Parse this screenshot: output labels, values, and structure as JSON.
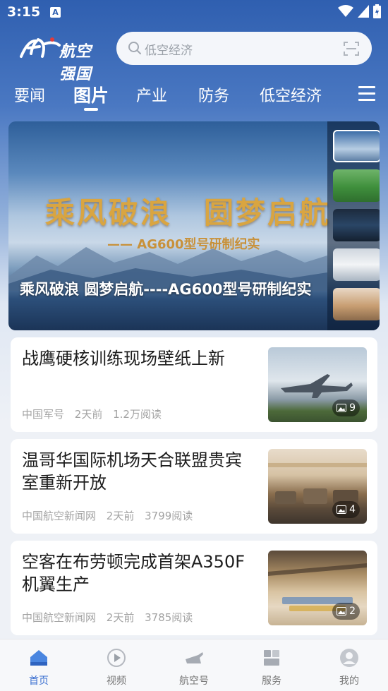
{
  "status_bar": {
    "time": "3:15",
    "notif_icon": "a-notification-icon"
  },
  "header": {
    "logo_text": "航空强国",
    "search": {
      "placeholder": "低空经济"
    }
  },
  "tabs": [
    {
      "label": "要闻"
    },
    {
      "label": "图片"
    },
    {
      "label": "产业"
    },
    {
      "label": "防务"
    },
    {
      "label": "低空经济"
    }
  ],
  "active_tab": "图片",
  "banner": {
    "big_title": "乘风破浪　圆梦启航",
    "subtitle": "—— AG600型号研制纪实",
    "caption": "乘风破浪 圆梦启航----AG600型号研制纪实"
  },
  "news": [
    {
      "title": "战鹰硬核训练现场壁纸上新",
      "source": "中国军号",
      "time": "2天前",
      "reads": "1.2万阅读",
      "image_count": "9"
    },
    {
      "title": "温哥华国际机场天合联盟贵宾室重新开放",
      "source": "中国航空新闻网",
      "time": "2天前",
      "reads": "3799阅读",
      "image_count": "4"
    },
    {
      "title": "空客在布劳顿完成首架A350F机翼生产",
      "source": "中国航空新闻网",
      "time": "2天前",
      "reads": "3785阅读",
      "image_count": "2"
    }
  ],
  "bottom_nav": [
    {
      "label": "首页",
      "icon": "home-icon"
    },
    {
      "label": "视频",
      "icon": "video-play-icon"
    },
    {
      "label": "航空号",
      "icon": "aircraft-icon"
    },
    {
      "label": "服务",
      "icon": "services-grid-icon"
    },
    {
      "label": "我的",
      "icon": "user-icon"
    }
  ],
  "colors": {
    "accent": "#3a6fd0",
    "header_blue": "#2f5fb0",
    "banner_gold": "#d9a541"
  }
}
